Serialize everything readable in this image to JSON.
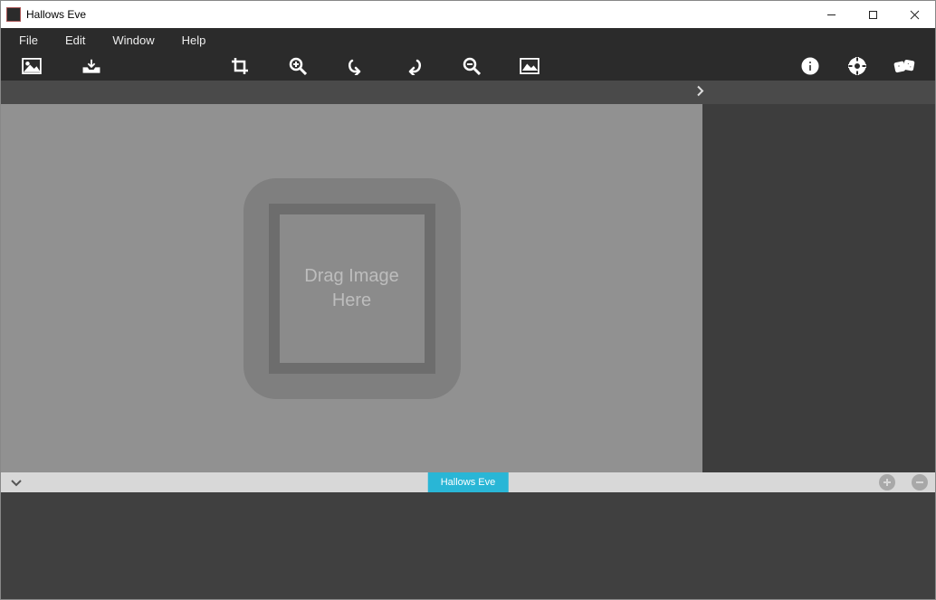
{
  "window": {
    "title": "Hallows Eve"
  },
  "menu": {
    "file": "File",
    "edit": "Edit",
    "window": "Window",
    "help": "Help"
  },
  "dropzone": {
    "text": "Drag Image Here"
  },
  "tabs": {
    "active": "Hallows Eve"
  },
  "icons": {
    "image": "image-icon",
    "inbox": "inbox-icon",
    "crop": "crop-icon",
    "zoom_in": "zoom-in-icon",
    "undo": "undo-icon",
    "redo": "redo-icon",
    "zoom_out": "zoom-out-icon",
    "picture": "picture-icon",
    "info": "info-icon",
    "support": "support-icon",
    "dice": "dice-icon"
  },
  "colors": {
    "accent": "#29b6d6",
    "canvas": "#919191",
    "panel": "#3d3d3d",
    "toolbar": "#2b2b2b"
  }
}
